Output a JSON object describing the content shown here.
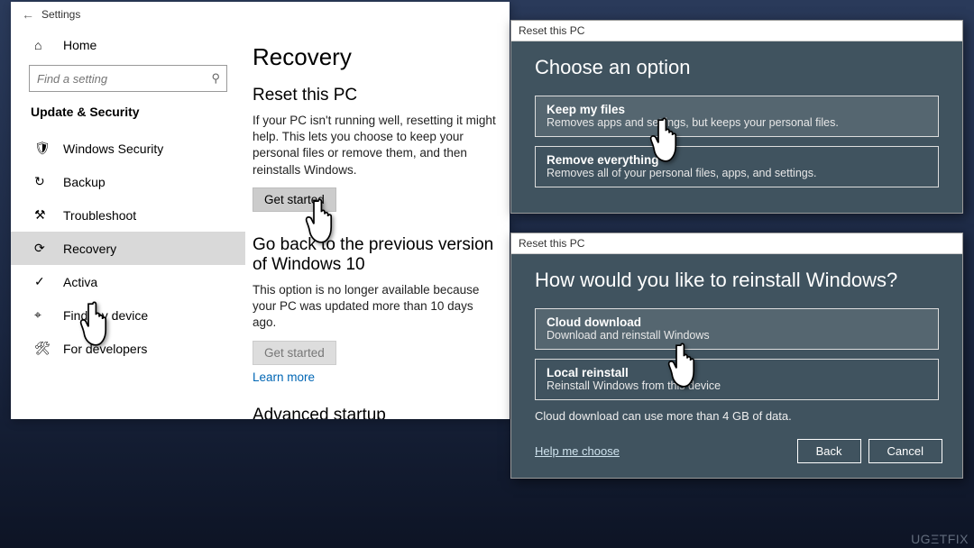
{
  "settings": {
    "window_title": "Settings",
    "home_label": "Home",
    "search_placeholder": "Find a setting",
    "category": "Update & Security",
    "nav": [
      {
        "icon": "shield",
        "label": "Windows Security"
      },
      {
        "icon": "backup",
        "label": "Backup"
      },
      {
        "icon": "wrench",
        "label": "Troubleshoot"
      },
      {
        "icon": "recovery",
        "label": "Recovery"
      },
      {
        "icon": "check",
        "label": "Activa"
      },
      {
        "icon": "location",
        "label": "Find my device"
      },
      {
        "icon": "dev",
        "label": "For developers"
      }
    ]
  },
  "main": {
    "heading": "Recovery",
    "reset": {
      "heading": "Reset this PC",
      "body": "If your PC isn't running well, resetting it might help. This lets you choose to keep your personal files or remove them, and then reinstalls Windows.",
      "button": "Get started"
    },
    "goback": {
      "heading": "Go back to the previous version of Windows 10",
      "body": "This option is no longer available because your PC was updated more than 10 days ago.",
      "button": "Get started",
      "learn_more": "Learn more"
    },
    "advanced_heading": "Advanced startup"
  },
  "dialog1": {
    "titlebar": "Reset this PC",
    "heading": "Choose an option",
    "options": [
      {
        "title": "Keep my files",
        "desc": "Removes apps and settings, but keeps your personal files."
      },
      {
        "title": "Remove everything",
        "desc": "Removes all of your personal files, apps, and settings."
      }
    ]
  },
  "dialog2": {
    "titlebar": "Reset this PC",
    "heading": "How would you like to reinstall Windows?",
    "options": [
      {
        "title": "Cloud download",
        "desc": "Download and reinstall Windows"
      },
      {
        "title": "Local reinstall",
        "desc": "Reinstall Windows from this device"
      }
    ],
    "note": "Cloud download can use more than 4 GB of data.",
    "help": "Help me choose",
    "back": "Back",
    "cancel": "Cancel"
  },
  "watermark": "UGΞTFIX"
}
